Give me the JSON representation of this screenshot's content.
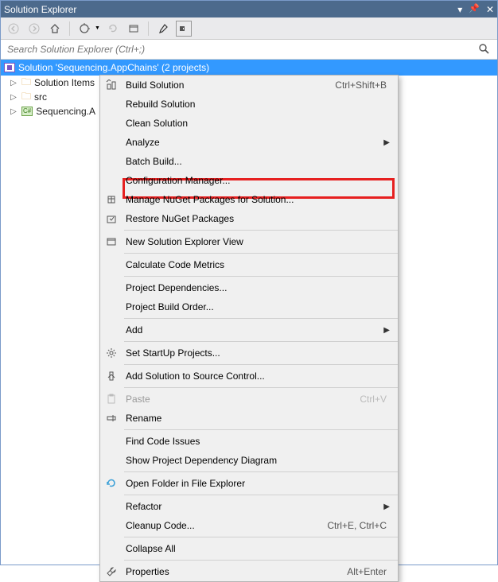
{
  "titlebar": {
    "title": "Solution Explorer"
  },
  "search": {
    "placeholder": "Search Solution Explorer (Ctrl+;)"
  },
  "tree": {
    "solution_label": "Solution 'Sequencing.AppChains' (2 projects)",
    "items": [
      {
        "label": "Solution Items"
      },
      {
        "label": "src"
      },
      {
        "label": "Sequencing.A"
      }
    ]
  },
  "ctx": {
    "build": "Build Solution",
    "build_short": "Ctrl+Shift+B",
    "rebuild": "Rebuild Solution",
    "clean": "Clean Solution",
    "analyze": "Analyze",
    "batch": "Batch Build...",
    "config": "Configuration Manager...",
    "nuget_mgr": "Manage NuGet Packages for Solution...",
    "nuget_restore": "Restore NuGet Packages",
    "new_view": "New Solution Explorer View",
    "metrics": "Calculate Code Metrics",
    "deps": "Project Dependencies...",
    "build_order": "Project Build Order...",
    "add": "Add",
    "startup": "Set StartUp Projects...",
    "scm": "Add Solution to Source Control...",
    "paste": "Paste",
    "paste_short": "Ctrl+V",
    "rename": "Rename",
    "find_issues": "Find Code Issues",
    "dep_diagram": "Show Project Dependency Diagram",
    "open_folder": "Open Folder in File Explorer",
    "refactor": "Refactor",
    "cleanup": "Cleanup Code...",
    "cleanup_short": "Ctrl+E, Ctrl+C",
    "collapse": "Collapse All",
    "props": "Properties",
    "props_short": "Alt+Enter"
  }
}
